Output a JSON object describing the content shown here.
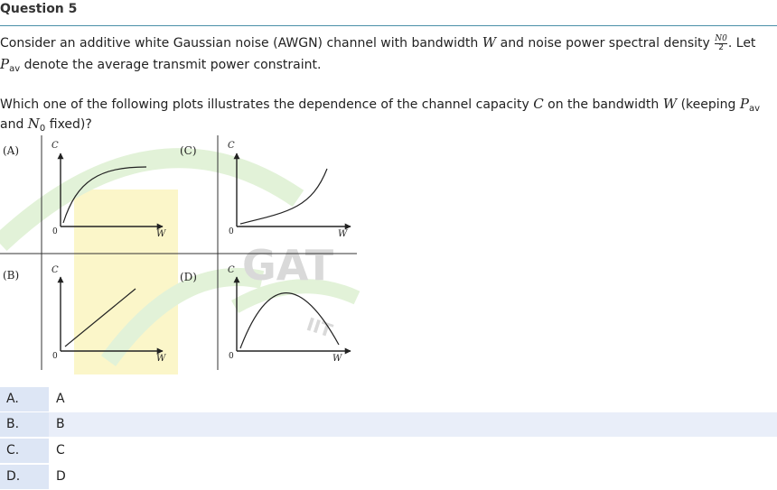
{
  "question": {
    "title": "Question 5",
    "line1_a": "Consider an additive white Gaussian noise (AWGN) channel with bandwidth",
    "var_W": "W",
    "line1_b": "and noise power spectral density",
    "frac_num": "N0",
    "frac_den": "2",
    "line1_c": ". Let",
    "var_P": "P",
    "sub_av": "av",
    "line2": "denote the average transmit power constraint.",
    "line3_a": "Which one of the following plots illustrates the dependence of the channel capacity",
    "var_C": "C",
    "line3_b": "on the bandwidth",
    "line3_c": "(keeping",
    "line4_a": "and",
    "var_N": "N",
    "sub_0": "0",
    "line4_b": "fixed)?"
  },
  "figure": {
    "panels": [
      {
        "label": "(A)",
        "axis_y": "C",
        "origin": "0",
        "axis_x": "W",
        "curve": "saturating"
      },
      {
        "label": "(C)",
        "axis_y": "C",
        "origin": "0",
        "axis_x": "W",
        "curve": "convex-increasing"
      },
      {
        "label": "(B)",
        "axis_y": "C",
        "origin": "0",
        "axis_x": "W",
        "curve": "linear"
      },
      {
        "label": "(D)",
        "axis_y": "C",
        "origin": "0",
        "axis_x": "W",
        "curve": "peaked"
      }
    ],
    "watermark_text": "GAT",
    "watermark_sub": "IIT"
  },
  "options": [
    {
      "letter": "A.",
      "text": "A",
      "highlight": false
    },
    {
      "letter": "B.",
      "text": "B",
      "highlight": true
    },
    {
      "letter": "C.",
      "text": "C",
      "highlight": false
    },
    {
      "letter": "D.",
      "text": "D",
      "highlight": false
    }
  ],
  "colors": {
    "option_letter_bg": "#dde6f5",
    "highlight_row_bg": "#e9eef9",
    "title_rule": "#4a90a8",
    "watermark_yellow": "#fbf6c9",
    "watermark_green": "#e2f2d8"
  }
}
